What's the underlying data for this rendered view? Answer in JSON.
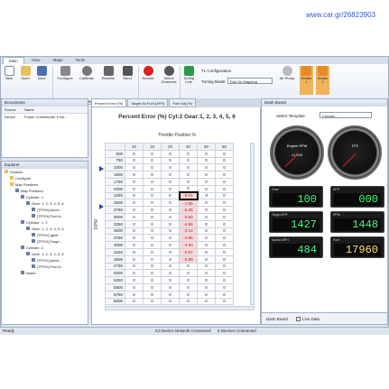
{
  "watermark": "www.car.gr/26823903",
  "menu": {
    "tabs": [
      "Main",
      "View",
      "Maps",
      "Tools"
    ],
    "active_tab": "Main"
  },
  "ribbon": {
    "file_buttons": [
      "New",
      "Open",
      "Save"
    ],
    "device_buttons": [
      "Configure",
      "Calibrate",
      "Receive",
      "Send"
    ],
    "logging_buttons": [
      "Record",
      "Select Channels"
    ],
    "tuning_link": "Tuning Link",
    "tl_config": "TL Configuration",
    "tuning_mode_label": "Tuning Mode:",
    "tuning_mode_value": "Roll On Mapping",
    "tools_buttons": [
      "Air Pump",
      "Heater 1",
      "Heater 2"
    ],
    "groups": [
      "File",
      "Device",
      "Logging",
      "Tuning Tools"
    ]
  },
  "documents_panel": {
    "title": "Documents",
    "columns": [
      "Source",
      "Name"
    ],
    "rows": [
      {
        "source": "Device",
        "name": "Power Commander 5 Ne..."
      }
    ]
  },
  "explorer_panel": {
    "title": "Explorer",
    "tree": [
      {
        "label": "Solution",
        "level": 0
      },
      {
        "label": "Configure",
        "level": 1
      },
      {
        "label": "Map Positions",
        "level": 1
      },
      {
        "label": "Map Position1",
        "level": 2
      },
      {
        "label": "Cylinder: 1",
        "level": 3
      },
      {
        "label": "Gear: 1, 2, 3, 4, 5, 6",
        "level": 4
      },
      {
        "label": "[TPS%] Autot...",
        "level": 5
      },
      {
        "label": "[TPS%] Fuel A...",
        "level": 5
      },
      {
        "label": "Cylinder: 1, 2",
        "level": 3
      },
      {
        "label": "Gear: 1, 2, 3, 4, 5, 6",
        "level": 4
      },
      {
        "label": "[TPS%] Igniti...",
        "level": 5
      },
      {
        "label": "[TPS%] Targe...",
        "level": 5
      },
      {
        "label": "Cylinder: 2",
        "level": 3
      },
      {
        "label": "Gear: 1, 2, 3, 4, 5, 6",
        "level": 4
      },
      {
        "label": "[TPS%] Autot...",
        "level": 5
      },
      {
        "label": "[TPS%] Fuel A...",
        "level": 5
      },
      {
        "label": "Notes",
        "level": 3
      }
    ]
  },
  "doc_tabs": [
    "Percent Error (%)",
    "Target Air,Fuel (AFR)",
    "Fuel Adj (%)"
  ],
  "table": {
    "title": "Percent Error (%)  Cyl:2  Gear:1, 2, 3, 4, 5, 6",
    "subtitle": "Throttle Position %",
    "y_label": "RPM",
    "columns": [
      "10",
      "15",
      "20",
      "40",
      "60",
      "80"
    ],
    "rows": [
      {
        "rpm": "500",
        "vals": [
          "0",
          "0",
          "0",
          "0",
          "0",
          "0"
        ]
      },
      {
        "rpm": "750",
        "vals": [
          "0",
          "0",
          "0",
          "0",
          "0",
          "0"
        ]
      },
      {
        "rpm": "1000",
        "vals": [
          "0",
          "0",
          "0",
          "0",
          "0",
          "0"
        ]
      },
      {
        "rpm": "1500",
        "vals": [
          "0",
          "0",
          "0",
          "0",
          "0",
          "0"
        ]
      },
      {
        "rpm": "1750",
        "vals": [
          "0",
          "0",
          "0",
          "0",
          "0",
          "0"
        ]
      },
      {
        "rpm": "2000",
        "vals": [
          "0",
          "0",
          "0",
          "0",
          "0",
          "0"
        ]
      },
      {
        "rpm": "2250",
        "vals": [
          "0",
          "0",
          "0",
          "-9.01",
          "0",
          "0"
        ]
      },
      {
        "rpm": "2500",
        "vals": [
          "0",
          "0",
          "0",
          "-1.05",
          "0",
          "0"
        ]
      },
      {
        "rpm": "2750",
        "vals": [
          "0",
          "0",
          "0",
          "-6.36",
          "0",
          "0"
        ]
      },
      {
        "rpm": "3000",
        "vals": [
          "0",
          "0",
          "0",
          "-0.93",
          "0",
          "0"
        ]
      },
      {
        "rpm": "3250",
        "vals": [
          "0",
          "0",
          "0",
          "-4.96",
          "0",
          "0"
        ]
      },
      {
        "rpm": "3500",
        "vals": [
          "0",
          "0",
          "0",
          "-2.13",
          "0",
          "0"
        ]
      },
      {
        "rpm": "3750",
        "vals": [
          "0",
          "0",
          "0",
          "-4.86",
          "0",
          "0"
        ]
      },
      {
        "rpm": "4000",
        "vals": [
          "0",
          "0",
          "0",
          "-4.93",
          "0",
          "0"
        ]
      },
      {
        "rpm": "4250",
        "vals": [
          "0",
          "0",
          "0",
          "-2.57",
          "0",
          "0"
        ]
      },
      {
        "rpm": "4500",
        "vals": [
          "0",
          "0",
          "0",
          "-6.99",
          "0",
          "0"
        ]
      },
      {
        "rpm": "4750",
        "vals": [
          "0",
          "0",
          "0",
          "0",
          "0",
          "0"
        ]
      },
      {
        "rpm": "5000",
        "vals": [
          "0",
          "0",
          "0",
          "0",
          "0",
          "0"
        ]
      },
      {
        "rpm": "5250",
        "vals": [
          "0",
          "0",
          "0",
          "0",
          "0",
          "0"
        ]
      },
      {
        "rpm": "5500",
        "vals": [
          "0",
          "0",
          "0",
          "0",
          "0",
          "0"
        ]
      },
      {
        "rpm": "5750",
        "vals": [
          "0",
          "0",
          "0",
          "0",
          "0",
          "0"
        ]
      },
      {
        "rpm": "6000",
        "vals": [
          "0",
          "0",
          "0",
          "0",
          "0",
          "0"
        ]
      }
    ]
  },
  "dashboard": {
    "title": "Dash Board",
    "template_label": "Select Template",
    "template_value": "Choose...",
    "gauges": [
      {
        "label": "Engine RPM",
        "scale": "x1000"
      },
      {
        "label": "TPS",
        "scale": ""
      }
    ],
    "lcds": [
      {
        "label": "Gear",
        "value": "100"
      },
      {
        "label": "AFR",
        "value": "000"
      },
      {
        "label": "Target AFR",
        "value": "1427"
      },
      {
        "label": "RPM",
        "value": "1448"
      },
      {
        "label": "Speed MPH",
        "value": "484"
      },
      {
        "label": "Fuel",
        "value": "17960"
      }
    ],
    "footer_tab": "Dash Board",
    "live_data_label": "Live Data"
  },
  "status": {
    "left": "Ready",
    "mid": "C3 Device Network Connected",
    "right": "6 Devices Connected"
  },
  "colors": {
    "accent": "#1f4fa5",
    "highlight": "#f7d9d9",
    "negative": "#a51c1c",
    "lcd_green": "#3cff7a",
    "lcd_yellow": "#ffe36b"
  }
}
